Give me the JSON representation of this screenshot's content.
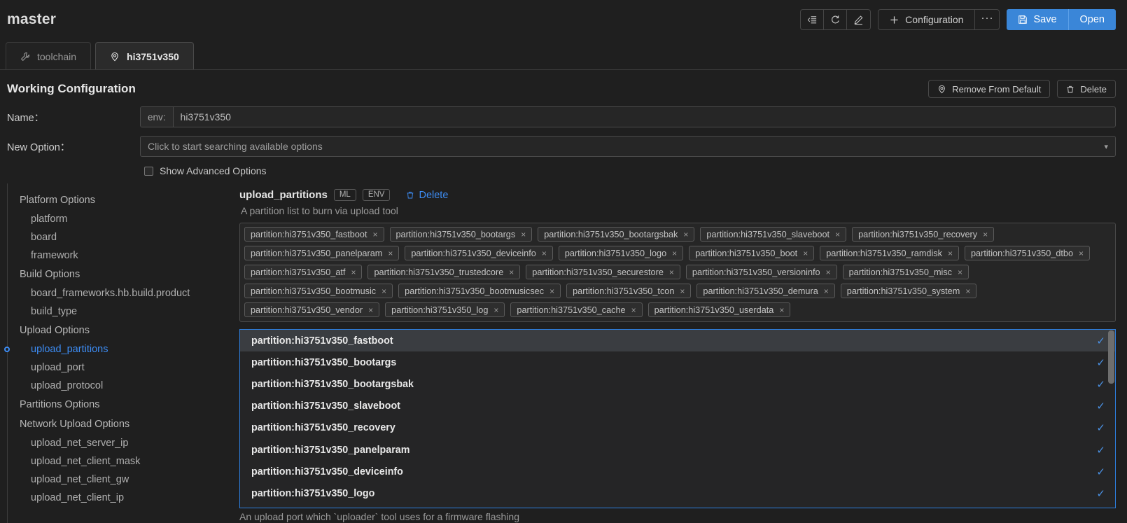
{
  "header": {
    "title": "master",
    "icon_buttons": [
      {
        "name": "list-tree-icon",
        "label": ""
      },
      {
        "name": "refresh-icon",
        "label": ""
      },
      {
        "name": "pencil-edit-icon",
        "label": ""
      }
    ],
    "configuration_label": "Configuration",
    "ellipsis_label": "···",
    "save_label": "Save",
    "open_label": "Open"
  },
  "tabs": [
    {
      "label": "toolchain",
      "icon": "wrench-icon",
      "active": false
    },
    {
      "label": "hi3751v350",
      "icon": "location-pin-icon",
      "active": true
    }
  ],
  "working_config": {
    "title": "Working Configuration",
    "remove_from_default_label": "Remove From Default",
    "delete_label": "Delete"
  },
  "form": {
    "name_label": "Name：",
    "name_prefix": "env:",
    "name_value": "hi3751v350",
    "new_option_label": "New Option：",
    "new_option_placeholder": "Click to start searching available options",
    "show_advanced_label": "Show Advanced Options"
  },
  "sidebar": {
    "groups": [
      {
        "label": "Platform Options",
        "items": [
          {
            "label": "platform",
            "selected": false
          },
          {
            "label": "board",
            "selected": false
          },
          {
            "label": "framework",
            "selected": false
          }
        ]
      },
      {
        "label": "Build Options",
        "items": [
          {
            "label": "board_frameworks.hb.build.product",
            "selected": false
          },
          {
            "label": "build_type",
            "selected": false
          }
        ]
      },
      {
        "label": "Upload Options",
        "items": [
          {
            "label": "upload_partitions",
            "selected": true
          },
          {
            "label": "upload_port",
            "selected": false
          },
          {
            "label": "upload_protocol",
            "selected": false
          }
        ]
      },
      {
        "label": "Partitions Options",
        "items": []
      },
      {
        "label": "Network Upload Options",
        "items": [
          {
            "label": "upload_net_server_ip",
            "selected": false
          },
          {
            "label": "upload_net_client_mask",
            "selected": false
          },
          {
            "label": "upload_net_client_gw",
            "selected": false
          },
          {
            "label": "upload_net_client_ip",
            "selected": false
          }
        ]
      }
    ]
  },
  "option": {
    "name": "upload_partitions",
    "badges": [
      "ML",
      "ENV"
    ],
    "delete_label": "Delete",
    "description": "A partition list to burn via upload tool",
    "tags": [
      "partition:hi3751v350_fastboot",
      "partition:hi3751v350_bootargs",
      "partition:hi3751v350_bootargsbak",
      "partition:hi3751v350_slaveboot",
      "partition:hi3751v350_recovery",
      "partition:hi3751v350_panelparam",
      "partition:hi3751v350_deviceinfo",
      "partition:hi3751v350_logo",
      "partition:hi3751v350_boot",
      "partition:hi3751v350_ramdisk",
      "partition:hi3751v350_dtbo",
      "partition:hi3751v350_atf",
      "partition:hi3751v350_trustedcore",
      "partition:hi3751v350_securestore",
      "partition:hi3751v350_versioninfo",
      "partition:hi3751v350_misc",
      "partition:hi3751v350_bootmusic",
      "partition:hi3751v350_bootmusicsec",
      "partition:hi3751v350_tcon",
      "partition:hi3751v350_demura",
      "partition:hi3751v350_system",
      "partition:hi3751v350_vendor",
      "partition:hi3751v350_log",
      "partition:hi3751v350_cache",
      "partition:hi3751v350_userdata"
    ],
    "tag_remove_glyph": "×"
  },
  "dropdown": {
    "check_glyph": "✓",
    "items": [
      {
        "label": "partition:hi3751v350_fastboot",
        "checked": true,
        "highlighted": true
      },
      {
        "label": "partition:hi3751v350_bootargs",
        "checked": true,
        "highlighted": false
      },
      {
        "label": "partition:hi3751v350_bootargsbak",
        "checked": true,
        "highlighted": false
      },
      {
        "label": "partition:hi3751v350_slaveboot",
        "checked": true,
        "highlighted": false
      },
      {
        "label": "partition:hi3751v350_recovery",
        "checked": true,
        "highlighted": false
      },
      {
        "label": "partition:hi3751v350_panelparam",
        "checked": true,
        "highlighted": false
      },
      {
        "label": "partition:hi3751v350_deviceinfo",
        "checked": true,
        "highlighted": false
      },
      {
        "label": "partition:hi3751v350_logo",
        "checked": true,
        "highlighted": false
      }
    ]
  },
  "bottom_description": "An upload port which `uploader` tool uses for a firmware flashing",
  "colors": {
    "accent_blue": "#3d8df5",
    "primary_button": "#3a86d8",
    "background": "#1f1f1f",
    "panel": "#262626"
  }
}
